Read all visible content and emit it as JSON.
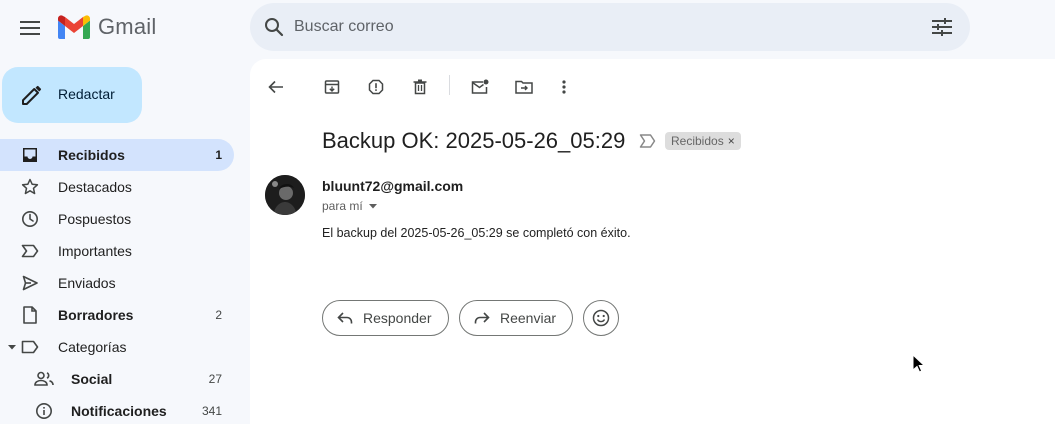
{
  "header": {
    "app_name": "Gmail",
    "search_placeholder": "Buscar correo"
  },
  "sidebar": {
    "compose_label": "Redactar",
    "items": [
      {
        "label": "Recibidos",
        "count": "1"
      },
      {
        "label": "Destacados",
        "count": ""
      },
      {
        "label": "Pospuestos",
        "count": ""
      },
      {
        "label": "Importantes",
        "count": ""
      },
      {
        "label": "Enviados",
        "count": ""
      },
      {
        "label": "Borradores",
        "count": "2"
      },
      {
        "label": "Categorías",
        "count": ""
      },
      {
        "label": "Social",
        "count": "27"
      },
      {
        "label": "Notificaciones",
        "count": "341"
      }
    ]
  },
  "email": {
    "subject": "Backup OK: 2025-05-26_05:29",
    "label_chip": "Recibidos",
    "label_chip_close": "×",
    "sender": "bluunt72@gmail.com",
    "recipient_line": "para mí",
    "body": "El backup del 2025-05-26_05:29 se completó con éxito."
  },
  "actions": {
    "reply_label": "Responder",
    "forward_label": "Reenviar"
  },
  "colors": {
    "background": "#f6f8fc",
    "compose_bg": "#c2e7ff",
    "active_nav_bg": "#d3e3fd",
    "search_bg": "#e9eef6"
  }
}
